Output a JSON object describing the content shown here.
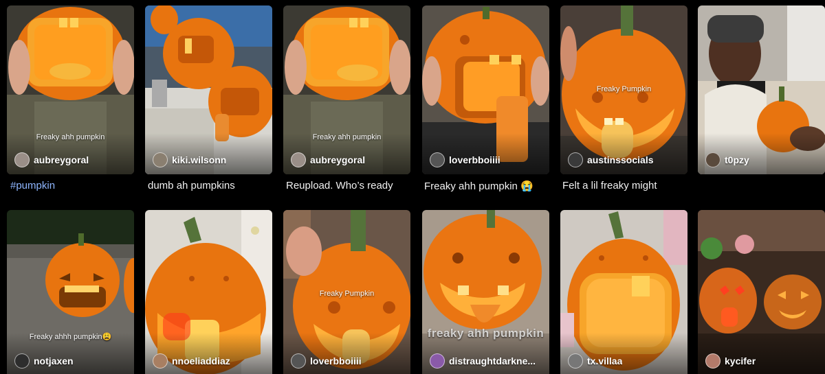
{
  "feed": {
    "row1": [
      {
        "author": "aubreygoral",
        "overlay": "Freaky ahh pumpkin",
        "caption": "#pumpkin",
        "avatar_color": "#9a8f88"
      },
      {
        "author": "kiki.wilsonn",
        "overlay": "",
        "caption": "dumb ah pumpkins",
        "avatar_color": "#8a7f70"
      },
      {
        "author": "aubreygoral",
        "overlay": "Freaky ahh pumpkin",
        "caption": "Reupload. Who’s ready",
        "avatar_color": "#9a8f88"
      },
      {
        "author": "loverbboiiii",
        "overlay": "",
        "caption": "Freaky ahh pumpkin 😭",
        "avatar_color": "#555555"
      },
      {
        "author": "austinssocials",
        "overlay": "Freaky Pumpkin",
        "caption": "Felt a lil freaky might",
        "avatar_color": "#3a3a3a"
      },
      {
        "author": "t0pzy",
        "overlay": "",
        "caption": "",
        "avatar_color": "#5a4a3c"
      }
    ],
    "row2": [
      {
        "author": "notjaxen",
        "overlay": "Freaky ahhh pumpkin😩",
        "avatar_color": "#2d2d2d"
      },
      {
        "author": "nnoeliaddiaz",
        "overlay": "",
        "avatar_color": "#a87f62"
      },
      {
        "author": "loverbboiiii",
        "overlay": "Freaky Pumpkin",
        "avatar_color": "#555555"
      },
      {
        "author": "distraughtdarkne...",
        "overlay": "freaky ahh pumpkin",
        "avatar_color": "#8a5aa8"
      },
      {
        "author": "tx.villaa",
        "overlay": "",
        "avatar_color": "#777777"
      },
      {
        "author": "kycifer",
        "overlay": "",
        "avatar_color": "#b37a6a"
      }
    ]
  },
  "colors": {
    "background": "#000000",
    "hashtag": "#8fb6ff",
    "pumpkin": "#e8740f"
  }
}
